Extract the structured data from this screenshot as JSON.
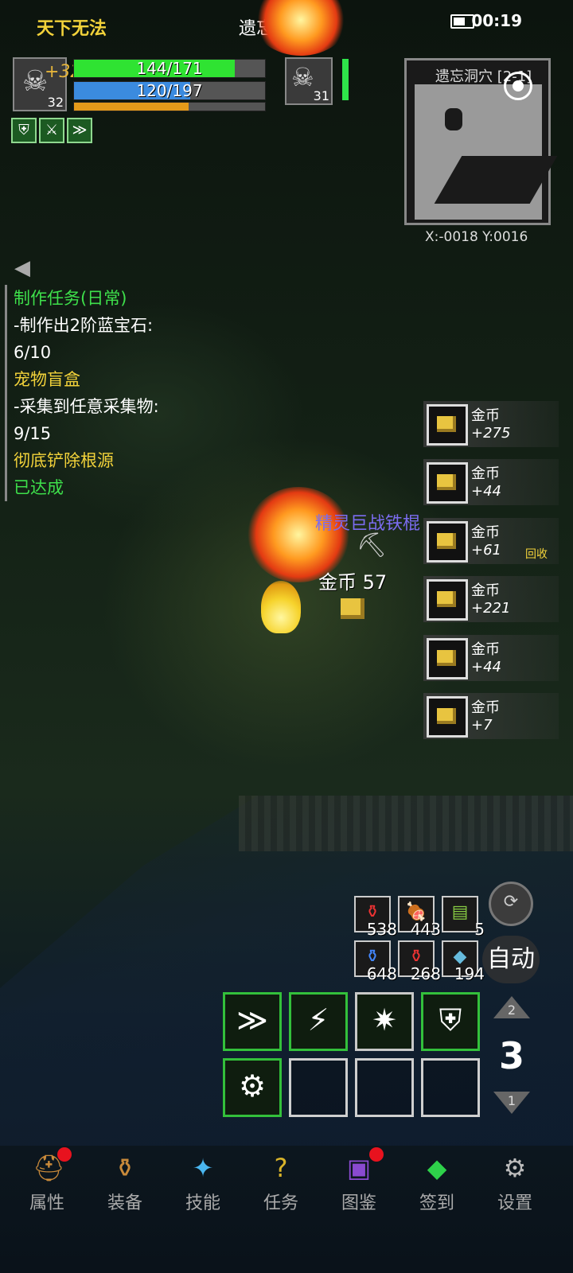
{
  "status_bar": {
    "left_title": "天下无法",
    "center_title": "遗忘洞穴",
    "time": "00:19"
  },
  "player": {
    "level": "32",
    "hp": "144/171",
    "hp_fraction": 0.84,
    "mp": "120/197",
    "mp_fraction": 0.61,
    "exp_fraction": 0.6,
    "damage_popup": "+322"
  },
  "buffs": [
    {
      "icon": "shield-buff-icon",
      "glyph": "⛨"
    },
    {
      "icon": "sword-shield-buff-icon",
      "glyph": "⚔"
    },
    {
      "icon": "dash-buff-icon",
      "glyph": "≫"
    }
  ],
  "target": {
    "level": "31",
    "hp_fraction": 1.0
  },
  "minimap": {
    "title": "遗忘洞穴 [2-1]",
    "coords": "X:-0018  Y:0016"
  },
  "quests": [
    {
      "text": "制作任务(日常)",
      "color": "green"
    },
    {
      "text": "-制作出2阶蓝宝石:",
      "color": "white"
    },
    {
      "text": "6/10",
      "color": "white"
    },
    {
      "text": "宠物盲盒",
      "color": "yellow"
    },
    {
      "text": "-采集到任意采集物:",
      "color": "white"
    },
    {
      "text": "9/15",
      "color": "white"
    },
    {
      "text": "彻底铲除根源",
      "color": "yellow"
    },
    {
      "text": "已达成",
      "color": "green"
    }
  ],
  "loot": [
    {
      "name": "金币",
      "amount": "+275"
    },
    {
      "name": "金币",
      "amount": "+44"
    },
    {
      "name": "金币",
      "amount": "+61"
    },
    {
      "name": "金币",
      "amount": "+221"
    },
    {
      "name": "金币",
      "amount": "+44"
    },
    {
      "name": "金币",
      "amount": "+7"
    }
  ],
  "recycle_label": "回收",
  "world": {
    "weapon_name": "精灵巨战铁棍",
    "gold_popup": "金币 57"
  },
  "items": [
    {
      "icon": "red-potion-small-icon",
      "glyph": "⚱",
      "color": "#e33",
      "count": "538"
    },
    {
      "icon": "meat-icon",
      "glyph": "🍖",
      "color": "#e33",
      "count": "443"
    },
    {
      "icon": "scroll-icon",
      "glyph": "▤",
      "color": "#8c4",
      "count": "5"
    },
    {
      "icon": "blue-potion-icon",
      "glyph": "⚱",
      "color": "#48f",
      "count": "648"
    },
    {
      "icon": "red-potion-icon",
      "glyph": "⚱",
      "color": "#e33",
      "count": "268"
    },
    {
      "icon": "fish-icon",
      "glyph": "◆",
      "color": "#6bd",
      "count": "194"
    }
  ],
  "auto_label": "自动",
  "skills": [
    {
      "icon": "dash-skill-icon",
      "glyph": "≫",
      "state": "green"
    },
    {
      "icon": "claw-skill-icon",
      "glyph": "⚡",
      "state": "green"
    },
    {
      "icon": "burst-skill-icon",
      "glyph": "✷",
      "state": "gray"
    },
    {
      "icon": "shield-skill-icon",
      "glyph": "⛨",
      "state": "green"
    },
    {
      "icon": "gear-skill-icon",
      "glyph": "⚙",
      "state": "green"
    },
    {
      "icon": "",
      "glyph": "",
      "state": "empty"
    },
    {
      "icon": "",
      "glyph": "",
      "state": "empty"
    },
    {
      "icon": "",
      "glyph": "",
      "state": "empty"
    }
  ],
  "skill_page": {
    "up": "2",
    "current": "3",
    "down": "1"
  },
  "nav": [
    {
      "label": "属性",
      "icon": "helmet-icon",
      "glyph": "⛑",
      "color": "#c98a3a",
      "badge": true
    },
    {
      "label": "装备",
      "icon": "bag-icon",
      "glyph": "⚱",
      "color": "#c98a3a",
      "badge": false
    },
    {
      "label": "技能",
      "icon": "skill-orb-icon",
      "glyph": "✦",
      "color": "#4ab6f0",
      "badge": false
    },
    {
      "label": "任务",
      "icon": "question-icon",
      "glyph": "?",
      "color": "#d8b32a",
      "badge": false
    },
    {
      "label": "图鉴",
      "icon": "book-icon",
      "glyph": "▣",
      "color": "#8a4ad0",
      "badge": true
    },
    {
      "label": "签到",
      "icon": "gem-icon",
      "glyph": "◆",
      "color": "#2ed14a",
      "badge": false
    },
    {
      "label": "设置",
      "icon": "gear-icon",
      "glyph": "⚙",
      "color": "#bbb",
      "badge": false
    }
  ]
}
